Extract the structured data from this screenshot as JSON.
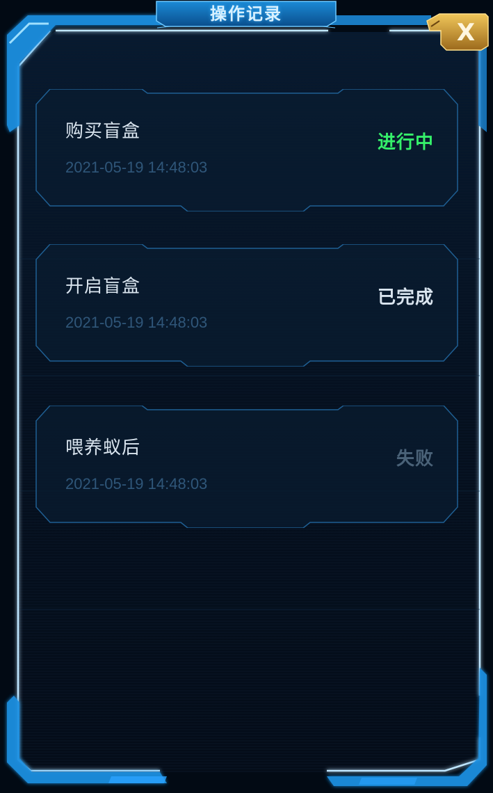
{
  "dialog": {
    "title": "操作记录",
    "close_label": "X",
    "accent_color": "#1e9bff",
    "gold_color": "#d4a236"
  },
  "records": [
    {
      "name": "购买盲盒",
      "time": "2021-05-19 14:48:03",
      "status": "进行中",
      "status_color": "#35f06a"
    },
    {
      "name": "开启盲盒",
      "time": "2021-05-19 14:48:03",
      "status": "已完成",
      "status_color": "#d9e4ee"
    },
    {
      "name": "喂养蚁后",
      "time": "2021-05-19 14:48:03",
      "status": "失败",
      "status_color": "#4a6278"
    }
  ]
}
